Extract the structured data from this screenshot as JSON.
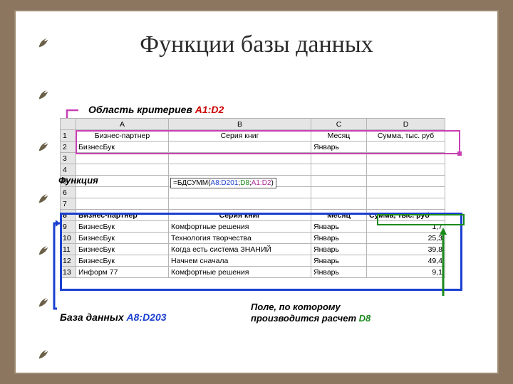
{
  "title": "Функции базы данных",
  "labels": {
    "criteria": "Область критериев",
    "criteria_ref": "A1:D2",
    "function": "Функция",
    "database": "База данных",
    "database_ref": "A8:D203",
    "field_line1": "Поле, по которому",
    "field_line2": "производится расчет",
    "field_ref": "D8"
  },
  "columns": [
    "A",
    "B",
    "C",
    "D"
  ],
  "criteria_row_header": [
    "Бизнес-партнер",
    "Серия книг",
    "Месяц",
    "Сумма, тыс. руб"
  ],
  "criteria_row_values": [
    "БизнесБук",
    "",
    "Январь",
    ""
  ],
  "formula": {
    "prefix": "=БДСУММ(",
    "arg1": "A8:D201",
    "arg2": "D8",
    "arg3": "A1:D2",
    "suffix": ")"
  },
  "data_header": [
    "Бизнес-партнер",
    "Серия книг",
    "Месяц",
    "Сумма, тыс. руб"
  ],
  "data_rows": [
    {
      "n": "9",
      "a": "БизнесБук",
      "b": "Комфортные решения",
      "c": "Январь",
      "d": "1,7"
    },
    {
      "n": "10",
      "a": "БизнесБук",
      "b": "Технология творчества",
      "c": "Январь",
      "d": "25,3"
    },
    {
      "n": "11",
      "a": "БизнесБук",
      "b": "Когда есть система ЗНАНИЙ",
      "c": "Январь",
      "d": "39,8"
    },
    {
      "n": "12",
      "a": "БизнесБук",
      "b": "Начнем сначала",
      "c": "Январь",
      "d": "49,4"
    },
    {
      "n": "13",
      "a": "Информ 77",
      "b": "Комфортные решения",
      "c": "Январь",
      "d": "9,1"
    }
  ],
  "blank_rows": [
    "3",
    "4",
    "5",
    "6",
    "7"
  ]
}
